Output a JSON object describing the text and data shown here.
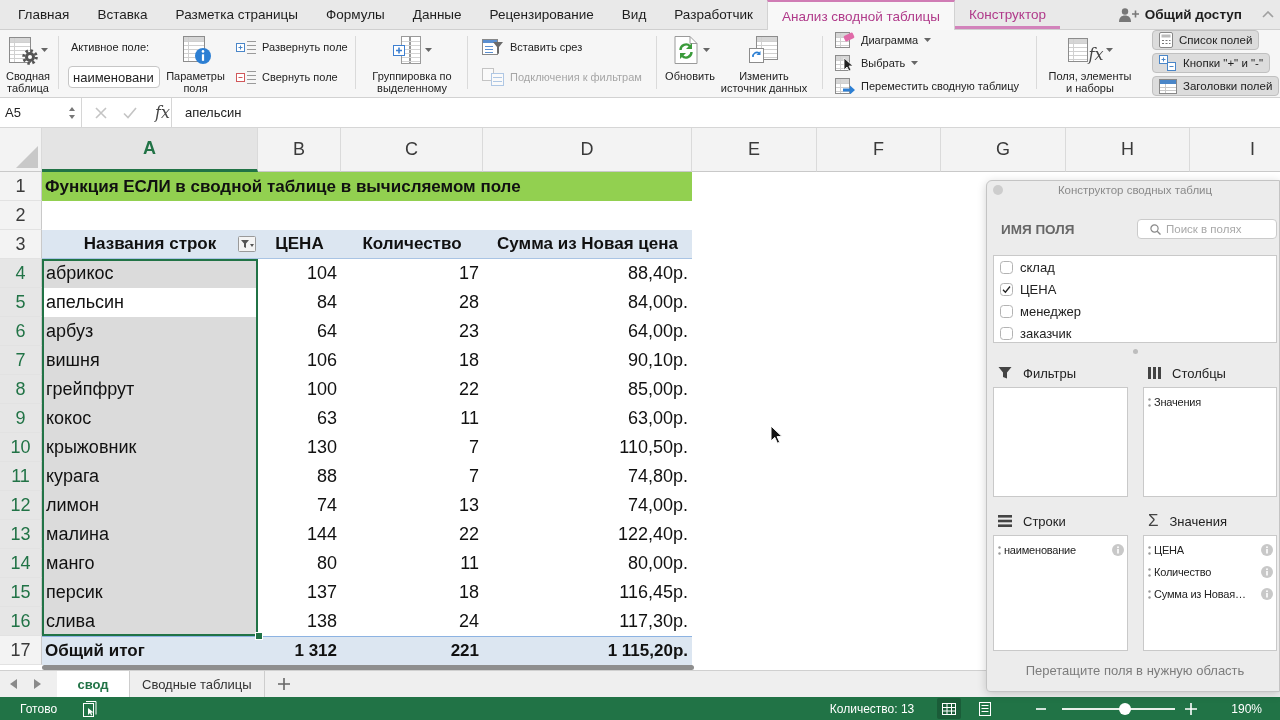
{
  "ribbon_tabs": [
    {
      "label": "Главная",
      "selected": false,
      "contextual": false
    },
    {
      "label": "Вставка",
      "selected": false,
      "contextual": false
    },
    {
      "label": "Разметка страницы",
      "selected": false,
      "contextual": false
    },
    {
      "label": "Формулы",
      "selected": false,
      "contextual": false
    },
    {
      "label": "Данные",
      "selected": false,
      "contextual": false
    },
    {
      "label": "Рецензирование",
      "selected": false,
      "contextual": false
    },
    {
      "label": "Вид",
      "selected": false,
      "contextual": false
    },
    {
      "label": "Разработчик",
      "selected": false,
      "contextual": false
    },
    {
      "label": "Анализ сводной таблицы",
      "selected": true,
      "contextual": true
    },
    {
      "label": "Конструктор",
      "selected": false,
      "contextual": true
    }
  ],
  "share_button": {
    "label": "Общий доступ"
  },
  "ribbon": {
    "pivot_table": {
      "label": "Сводная\nтаблица"
    },
    "active_field": {
      "label": "Активное поле:",
      "value": "наименовани"
    },
    "field_settings": {
      "label": "Параметры\nполя"
    },
    "expand_field": {
      "label": "Развернуть поле"
    },
    "collapse_field": {
      "label": "Свернуть поле"
    },
    "group_selection": {
      "label": "Группировка по\nвыделенному"
    },
    "insert_slicer": {
      "label": "Вставить срез"
    },
    "filter_connections": {
      "label": "Подключения к фильтрам",
      "disabled": true
    },
    "refresh": {
      "label": "Обновить"
    },
    "change_source": {
      "label": "Изменить\nисточник данных"
    },
    "chart": {
      "label": "Диаграмма"
    },
    "select": {
      "label": "Выбрать"
    },
    "move_pivot": {
      "label": "Переместить сводную таблицу"
    },
    "fields_items_sets": {
      "symbol": "fx",
      "label": "Поля, элементы\nи наборы"
    },
    "toggles": [
      {
        "label": "Список полей",
        "on": true
      },
      {
        "label": "Кнопки \"+\" и \"-\"",
        "on": true
      },
      {
        "label": "Заголовки полей",
        "on": true
      }
    ]
  },
  "formula_bar": {
    "cell": "A5",
    "symbol": "fx",
    "content": "апельсин"
  },
  "sheet": {
    "columns": [
      {
        "label": "A",
        "selected": true
      },
      {
        "label": "B",
        "selected": false
      },
      {
        "label": "C",
        "selected": false
      },
      {
        "label": "D",
        "selected": false
      },
      {
        "label": "E",
        "selected": false
      },
      {
        "label": "F",
        "selected": false
      },
      {
        "label": "G",
        "selected": false
      },
      {
        "label": "H",
        "selected": false
      },
      {
        "label": "I",
        "selected": false
      }
    ],
    "title_row": {
      "number": "1",
      "text": "Функция ЕСЛИ в сводной таблице в вычисляемом поле"
    },
    "blank_row": {
      "number": "2"
    },
    "header_row": {
      "number": "3",
      "cells": [
        "Названия строк",
        "ЦЕНА",
        "Количество",
        "Сумма из Новая цена"
      ]
    },
    "data_rows": [
      {
        "number": "4",
        "cells": [
          "абрикос",
          "104",
          "17",
          "88,40р."
        ],
        "selected": true,
        "active": false
      },
      {
        "number": "5",
        "cells": [
          "апельсин",
          "84",
          "28",
          "84,00р."
        ],
        "selected": true,
        "active": true
      },
      {
        "number": "6",
        "cells": [
          "арбуз",
          "64",
          "23",
          "64,00р."
        ],
        "selected": true,
        "active": false
      },
      {
        "number": "7",
        "cells": [
          "вишня",
          "106",
          "18",
          "90,10р."
        ],
        "selected": true,
        "active": false
      },
      {
        "number": "8",
        "cells": [
          "грейпфрут",
          "100",
          "22",
          "85,00р."
        ],
        "selected": true,
        "active": false
      },
      {
        "number": "9",
        "cells": [
          "кокос",
          "63",
          "11",
          "63,00р."
        ],
        "selected": true,
        "active": false
      },
      {
        "number": "10",
        "cells": [
          "крыжовник",
          "130",
          "7",
          "110,50р."
        ],
        "selected": true,
        "active": false
      },
      {
        "number": "11",
        "cells": [
          "курага",
          "88",
          "7",
          "74,80р."
        ],
        "selected": true,
        "active": false
      },
      {
        "number": "12",
        "cells": [
          "лимон",
          "74",
          "13",
          "74,00р."
        ],
        "selected": true,
        "active": false
      },
      {
        "number": "13",
        "cells": [
          "малина",
          "144",
          "22",
          "122,40р."
        ],
        "selected": true,
        "active": false
      },
      {
        "number": "14",
        "cells": [
          "манго",
          "80",
          "11",
          "80,00р."
        ],
        "selected": true,
        "active": false
      },
      {
        "number": "15",
        "cells": [
          "персик",
          "137",
          "18",
          "116,45р."
        ],
        "selected": true,
        "active": false
      },
      {
        "number": "16",
        "cells": [
          "слива",
          "138",
          "24",
          "117,30р."
        ],
        "selected": true,
        "active": false
      }
    ],
    "total_row": {
      "number": "17",
      "cells": [
        "Общий итог",
        "1 312",
        "221",
        "1 115,20р."
      ]
    }
  },
  "sheet_tabs": [
    {
      "label": "свод",
      "selected": true
    },
    {
      "label": "Сводные таблицы",
      "selected": false
    }
  ],
  "status_bar": {
    "mode": "Готово",
    "summary": "Количество: 13",
    "views": [
      {
        "kind": "normal",
        "selected": true
      },
      {
        "kind": "page_layout",
        "selected": false
      }
    ],
    "zoom": {
      "level": 0.56,
      "reading": "190%"
    }
  },
  "pivot_pane": {
    "title": "Конструктор сводных таблиц",
    "heading": "ИМЯ ПОЛЯ",
    "search": {
      "placeholder": "Поиск в полях"
    },
    "fields": [
      {
        "label": "склад",
        "checked": false
      },
      {
        "label": "ЦЕНА",
        "checked": true
      },
      {
        "label": "менеджер",
        "checked": false
      },
      {
        "label": "заказчик",
        "checked": false
      }
    ],
    "areas": [
      {
        "kind": "filters",
        "title": "Фильтры"
      },
      {
        "kind": "columns",
        "title": "Столбцы",
        "items": [
          {
            "label": "Значения"
          }
        ]
      },
      {
        "kind": "rows",
        "title": "Строки",
        "items": [
          {
            "label": "наименование"
          }
        ]
      },
      {
        "kind": "values",
        "symbol": "Σ",
        "title": "Значения",
        "items": [
          {
            "label": "ЦЕНА"
          },
          {
            "label": "Количество"
          },
          {
            "label": "Сумма из Новая…"
          }
        ]
      }
    ],
    "hint": "Перетащите поля в нужную область"
  }
}
